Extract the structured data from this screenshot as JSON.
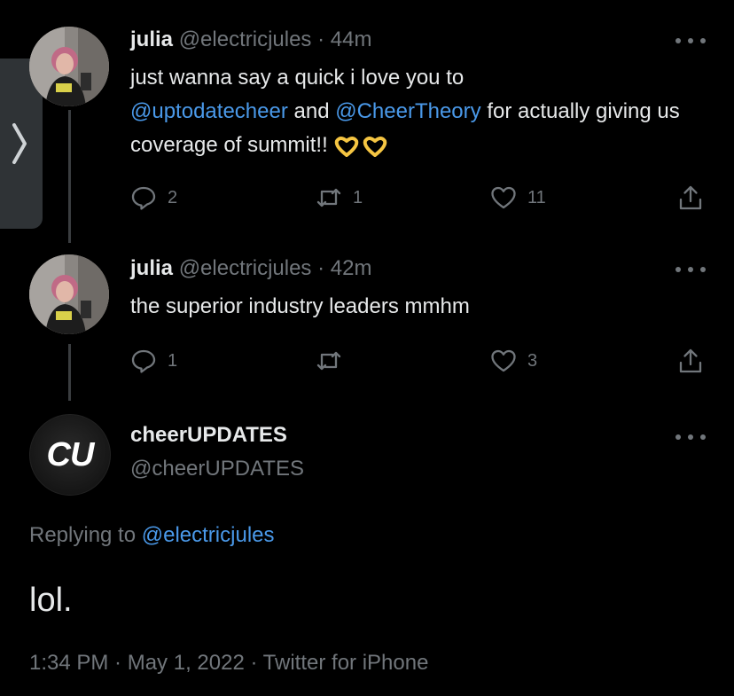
{
  "tweets": [
    {
      "name": "julia",
      "handle": "@electricjules",
      "separator": "·",
      "time": "44m",
      "text_parts": {
        "p1": "just wanna say a quick i love you to",
        "m1": "@uptodatecheer",
        "p2": " and ",
        "m2": "@CheerTheory",
        "p3": " for actually giving us coverage of summit!!"
      },
      "emoji": "heart-hands-emoji x2",
      "replies": "2",
      "retweets": "1",
      "likes": "11"
    },
    {
      "name": "julia",
      "handle": "@electricjules",
      "separator": "·",
      "time": "42m",
      "text": "the superior industry leaders mmhm",
      "replies": "1",
      "retweets": "",
      "likes": "3"
    }
  ],
  "main_tweet": {
    "avatar_text": "CU",
    "name": "cheerUPDATES",
    "handle": "@cheerUPDATES",
    "replying_prefix": "Replying to ",
    "replying_handle": "@electricjules",
    "text": "lol.",
    "meta": "1:34 PM · May 1, 2022 · Twitter for iPhone"
  },
  "colors": {
    "background": "#000000",
    "text": "#e7e9ea",
    "muted": "#71767b",
    "link": "#4a99e9",
    "emoji": "#f5c542"
  },
  "icons": [
    "chevron-right-icon",
    "more-icon",
    "reply-icon",
    "retweet-icon",
    "like-icon",
    "share-icon"
  ]
}
